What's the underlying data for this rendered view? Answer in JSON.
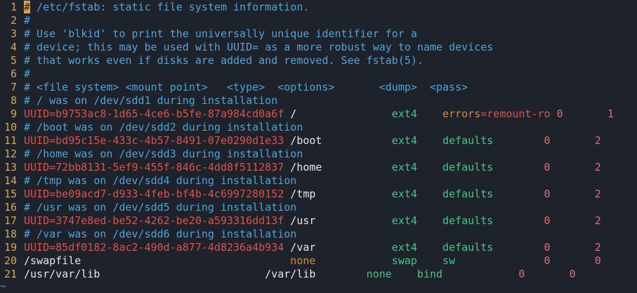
{
  "editor": {
    "lines": [
      {
        "num": "1",
        "segments": [
          {
            "t": "#",
            "c": "cursor"
          },
          {
            "t": " /etc/fstab: static file system information.",
            "c": "cmt"
          }
        ]
      },
      {
        "num": "2",
        "segments": [
          {
            "t": "#",
            "c": "cmt"
          }
        ]
      },
      {
        "num": "3",
        "segments": [
          {
            "t": "# Use 'blkid' to print the universally unique identifier for a",
            "c": "cmt"
          }
        ]
      },
      {
        "num": "4",
        "segments": [
          {
            "t": "# device; this may be used with UUID= as a more robust way to name devices",
            "c": "cmt"
          }
        ]
      },
      {
        "num": "5",
        "segments": [
          {
            "t": "# that works even if disks are added and removed. See fstab(5).",
            "c": "cmt"
          }
        ]
      },
      {
        "num": "6",
        "segments": [
          {
            "t": "#",
            "c": "cmt"
          }
        ]
      },
      {
        "num": "7",
        "segments": [
          {
            "t": "# <file system> <mount point>   <type>  <options>       <dump>  <pass>",
            "c": "cmt"
          }
        ]
      },
      {
        "num": "8",
        "segments": [
          {
            "t": "# / was on /dev/sdd1 during installation",
            "c": "cmt"
          }
        ]
      },
      {
        "num": "9",
        "segments": [
          {
            "t": "UUID",
            "c": "key"
          },
          {
            "t": "=b9753ac8-1d65-4ce6-b5fe-87a984cd0a6f",
            "c": "uuid"
          },
          {
            "t": " /               ",
            "c": "plain"
          },
          {
            "t": "ext4",
            "c": "type"
          },
          {
            "t": "    ",
            "c": "plain"
          },
          {
            "t": "errors",
            "c": "opt-orange"
          },
          {
            "t": "=remount-ro",
            "c": "uuid"
          },
          {
            "t": " ",
            "c": "plain"
          },
          {
            "t": "0",
            "c": "dump"
          },
          {
            "t": "       ",
            "c": "plain"
          },
          {
            "t": "1",
            "c": "pass"
          }
        ]
      },
      {
        "num": "10",
        "segments": [
          {
            "t": "# /boot was on /dev/sdd2 during installation",
            "c": "cmt"
          }
        ]
      },
      {
        "num": "11",
        "segments": [
          {
            "t": "UUID",
            "c": "key"
          },
          {
            "t": "=bd95c15e-433c-4b57-8491-07e0290d1e33",
            "c": "uuid"
          },
          {
            "t": " /boot           ",
            "c": "plain"
          },
          {
            "t": "ext4",
            "c": "type"
          },
          {
            "t": "    ",
            "c": "plain"
          },
          {
            "t": "defaults",
            "c": "opt-green"
          },
          {
            "t": "        ",
            "c": "plain"
          },
          {
            "t": "0",
            "c": "dump"
          },
          {
            "t": "       ",
            "c": "plain"
          },
          {
            "t": "2",
            "c": "pass"
          }
        ]
      },
      {
        "num": "12",
        "segments": [
          {
            "t": "# /home was on /dev/sdd3 during installation",
            "c": "cmt"
          }
        ]
      },
      {
        "num": "13",
        "segments": [
          {
            "t": "UUID",
            "c": "key"
          },
          {
            "t": "=72bb8131-5ef9-455f-846c-4dd8f5112837",
            "c": "uuid"
          },
          {
            "t": " /home           ",
            "c": "plain"
          },
          {
            "t": "ext4",
            "c": "type"
          },
          {
            "t": "    ",
            "c": "plain"
          },
          {
            "t": "defaults",
            "c": "opt-green"
          },
          {
            "t": "        ",
            "c": "plain"
          },
          {
            "t": "0",
            "c": "dump"
          },
          {
            "t": "       ",
            "c": "plain"
          },
          {
            "t": "2",
            "c": "pass"
          }
        ]
      },
      {
        "num": "14",
        "segments": [
          {
            "t": "# /tmp was on /dev/sdd4 during installation",
            "c": "cmt"
          }
        ]
      },
      {
        "num": "15",
        "segments": [
          {
            "t": "UUID",
            "c": "key"
          },
          {
            "t": "=be09acd7-d933-4feb-bf4b-4c6997280152",
            "c": "uuid"
          },
          {
            "t": " /tmp            ",
            "c": "plain"
          },
          {
            "t": "ext4",
            "c": "type"
          },
          {
            "t": "    ",
            "c": "plain"
          },
          {
            "t": "defaults",
            "c": "opt-green"
          },
          {
            "t": "        ",
            "c": "plain"
          },
          {
            "t": "0",
            "c": "dump"
          },
          {
            "t": "       ",
            "c": "plain"
          },
          {
            "t": "2",
            "c": "pass"
          }
        ]
      },
      {
        "num": "16",
        "segments": [
          {
            "t": "# /usr was on /dev/sdd5 during installation",
            "c": "cmt"
          }
        ]
      },
      {
        "num": "17",
        "segments": [
          {
            "t": "UUID",
            "c": "key"
          },
          {
            "t": "=3747e8ed-be52-4262-be20-a593316dd13f",
            "c": "uuid"
          },
          {
            "t": " /usr            ",
            "c": "plain"
          },
          {
            "t": "ext4",
            "c": "type"
          },
          {
            "t": "    ",
            "c": "plain"
          },
          {
            "t": "defaults",
            "c": "opt-green"
          },
          {
            "t": "        ",
            "c": "plain"
          },
          {
            "t": "0",
            "c": "dump"
          },
          {
            "t": "       ",
            "c": "plain"
          },
          {
            "t": "2",
            "c": "pass"
          }
        ]
      },
      {
        "num": "18",
        "segments": [
          {
            "t": "# /var was on /dev/sdd6 during installation",
            "c": "cmt"
          }
        ]
      },
      {
        "num": "19",
        "segments": [
          {
            "t": "UUID",
            "c": "key"
          },
          {
            "t": "=85df0182-8ac2-490d-a877-4d8236a4b934",
            "c": "uuid"
          },
          {
            "t": " /var            ",
            "c": "plain"
          },
          {
            "t": "ext4",
            "c": "type"
          },
          {
            "t": "    ",
            "c": "plain"
          },
          {
            "t": "defaults",
            "c": "opt-green"
          },
          {
            "t": "        ",
            "c": "plain"
          },
          {
            "t": "0",
            "c": "dump"
          },
          {
            "t": "       ",
            "c": "plain"
          },
          {
            "t": "2",
            "c": "pass"
          }
        ]
      },
      {
        "num": "20",
        "segments": [
          {
            "t": "/swapfile                                 ",
            "c": "plain"
          },
          {
            "t": "none",
            "c": "opt-orange"
          },
          {
            "t": "            ",
            "c": "plain"
          },
          {
            "t": "swap",
            "c": "type"
          },
          {
            "t": "    ",
            "c": "plain"
          },
          {
            "t": "sw",
            "c": "opt-green"
          },
          {
            "t": "              ",
            "c": "plain"
          },
          {
            "t": "0",
            "c": "dump"
          },
          {
            "t": "       ",
            "c": "plain"
          },
          {
            "t": "0",
            "c": "pass"
          }
        ]
      },
      {
        "num": "21",
        "segments": [
          {
            "t": "/usr/var/lib                          /var/lib        ",
            "c": "plain"
          },
          {
            "t": "none",
            "c": "type"
          },
          {
            "t": "    ",
            "c": "plain"
          },
          {
            "t": "bind",
            "c": "opt-green"
          },
          {
            "t": "            ",
            "c": "plain"
          },
          {
            "t": "0",
            "c": "dump"
          },
          {
            "t": "       ",
            "c": "plain"
          },
          {
            "t": "0",
            "c": "pass"
          }
        ]
      }
    ],
    "tilde": "~"
  },
  "colors": {
    "background": "#1e222a",
    "line_number": "#d8a657",
    "comment": "#4fa3d9",
    "uuid": "#d9534f",
    "type": "#4cc28b",
    "option_orange": "#d9893a",
    "number": "#e06c75"
  }
}
